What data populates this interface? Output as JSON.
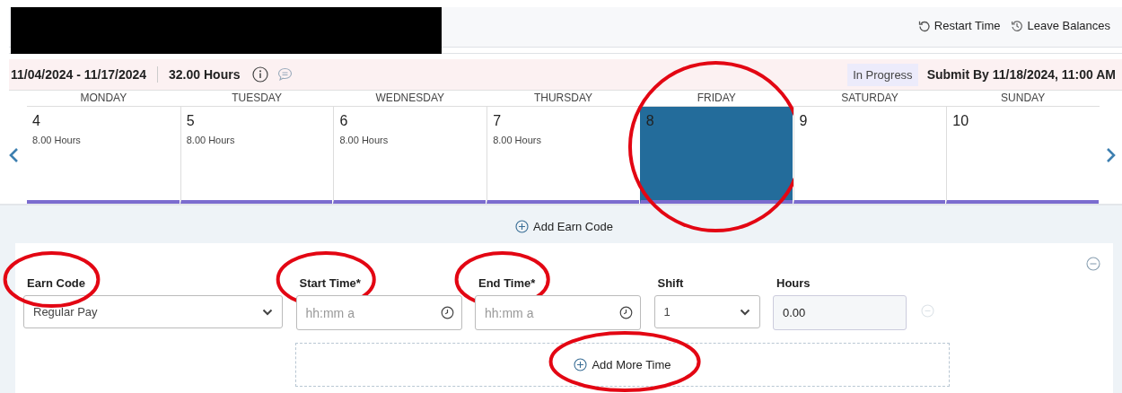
{
  "header": {
    "redacted": true,
    "actions": [
      {
        "kind": "restart",
        "label": "Restart Time"
      },
      {
        "kind": "balances",
        "label": "Leave Balances"
      }
    ]
  },
  "summary": {
    "period": "11/04/2024 - 11/17/2024",
    "total": "32.00 Hours",
    "status": "In Progress",
    "deadline": "Submit By 11/18/2024, 11:00 AM"
  },
  "week": {
    "days": [
      {
        "weekday": "MONDAY",
        "date": "4",
        "hours": "8.00 Hours",
        "selected": false,
        "circled": false
      },
      {
        "weekday": "TUESDAY",
        "date": "5",
        "hours": "8.00 Hours",
        "selected": false,
        "circled": false
      },
      {
        "weekday": "WEDNESDAY",
        "date": "6",
        "hours": "8.00 Hours",
        "selected": false,
        "circled": false
      },
      {
        "weekday": "THURSDAY",
        "date": "7",
        "hours": "8.00 Hours",
        "selected": false,
        "circled": false
      },
      {
        "weekday": "FRIDAY",
        "date": "8",
        "selected": true,
        "circled": true
      },
      {
        "weekday": "SATURDAY",
        "date": "9",
        "selected": false,
        "circled": false
      },
      {
        "weekday": "SUNDAY",
        "date": "10",
        "selected": false,
        "circled": false
      }
    ]
  },
  "add_earn_code": "Add Earn Code",
  "entry": {
    "fields": [
      {
        "kind": "select",
        "label": "Earn Code",
        "value": "Regular Pay",
        "circled": true
      },
      {
        "kind": "time",
        "label": "Start Time*",
        "placeholder": "hh:mm a",
        "circled": true
      },
      {
        "kind": "time",
        "label": "End Time*",
        "placeholder": "hh:mm a",
        "circled": true
      },
      {
        "kind": "select",
        "label": "Shift",
        "value": "1",
        "circled": false
      },
      {
        "kind": "readonly",
        "label": "Hours",
        "value": "0.00",
        "circled": false
      }
    ],
    "add_more": {
      "label": "Add More Time",
      "circled": true
    }
  }
}
